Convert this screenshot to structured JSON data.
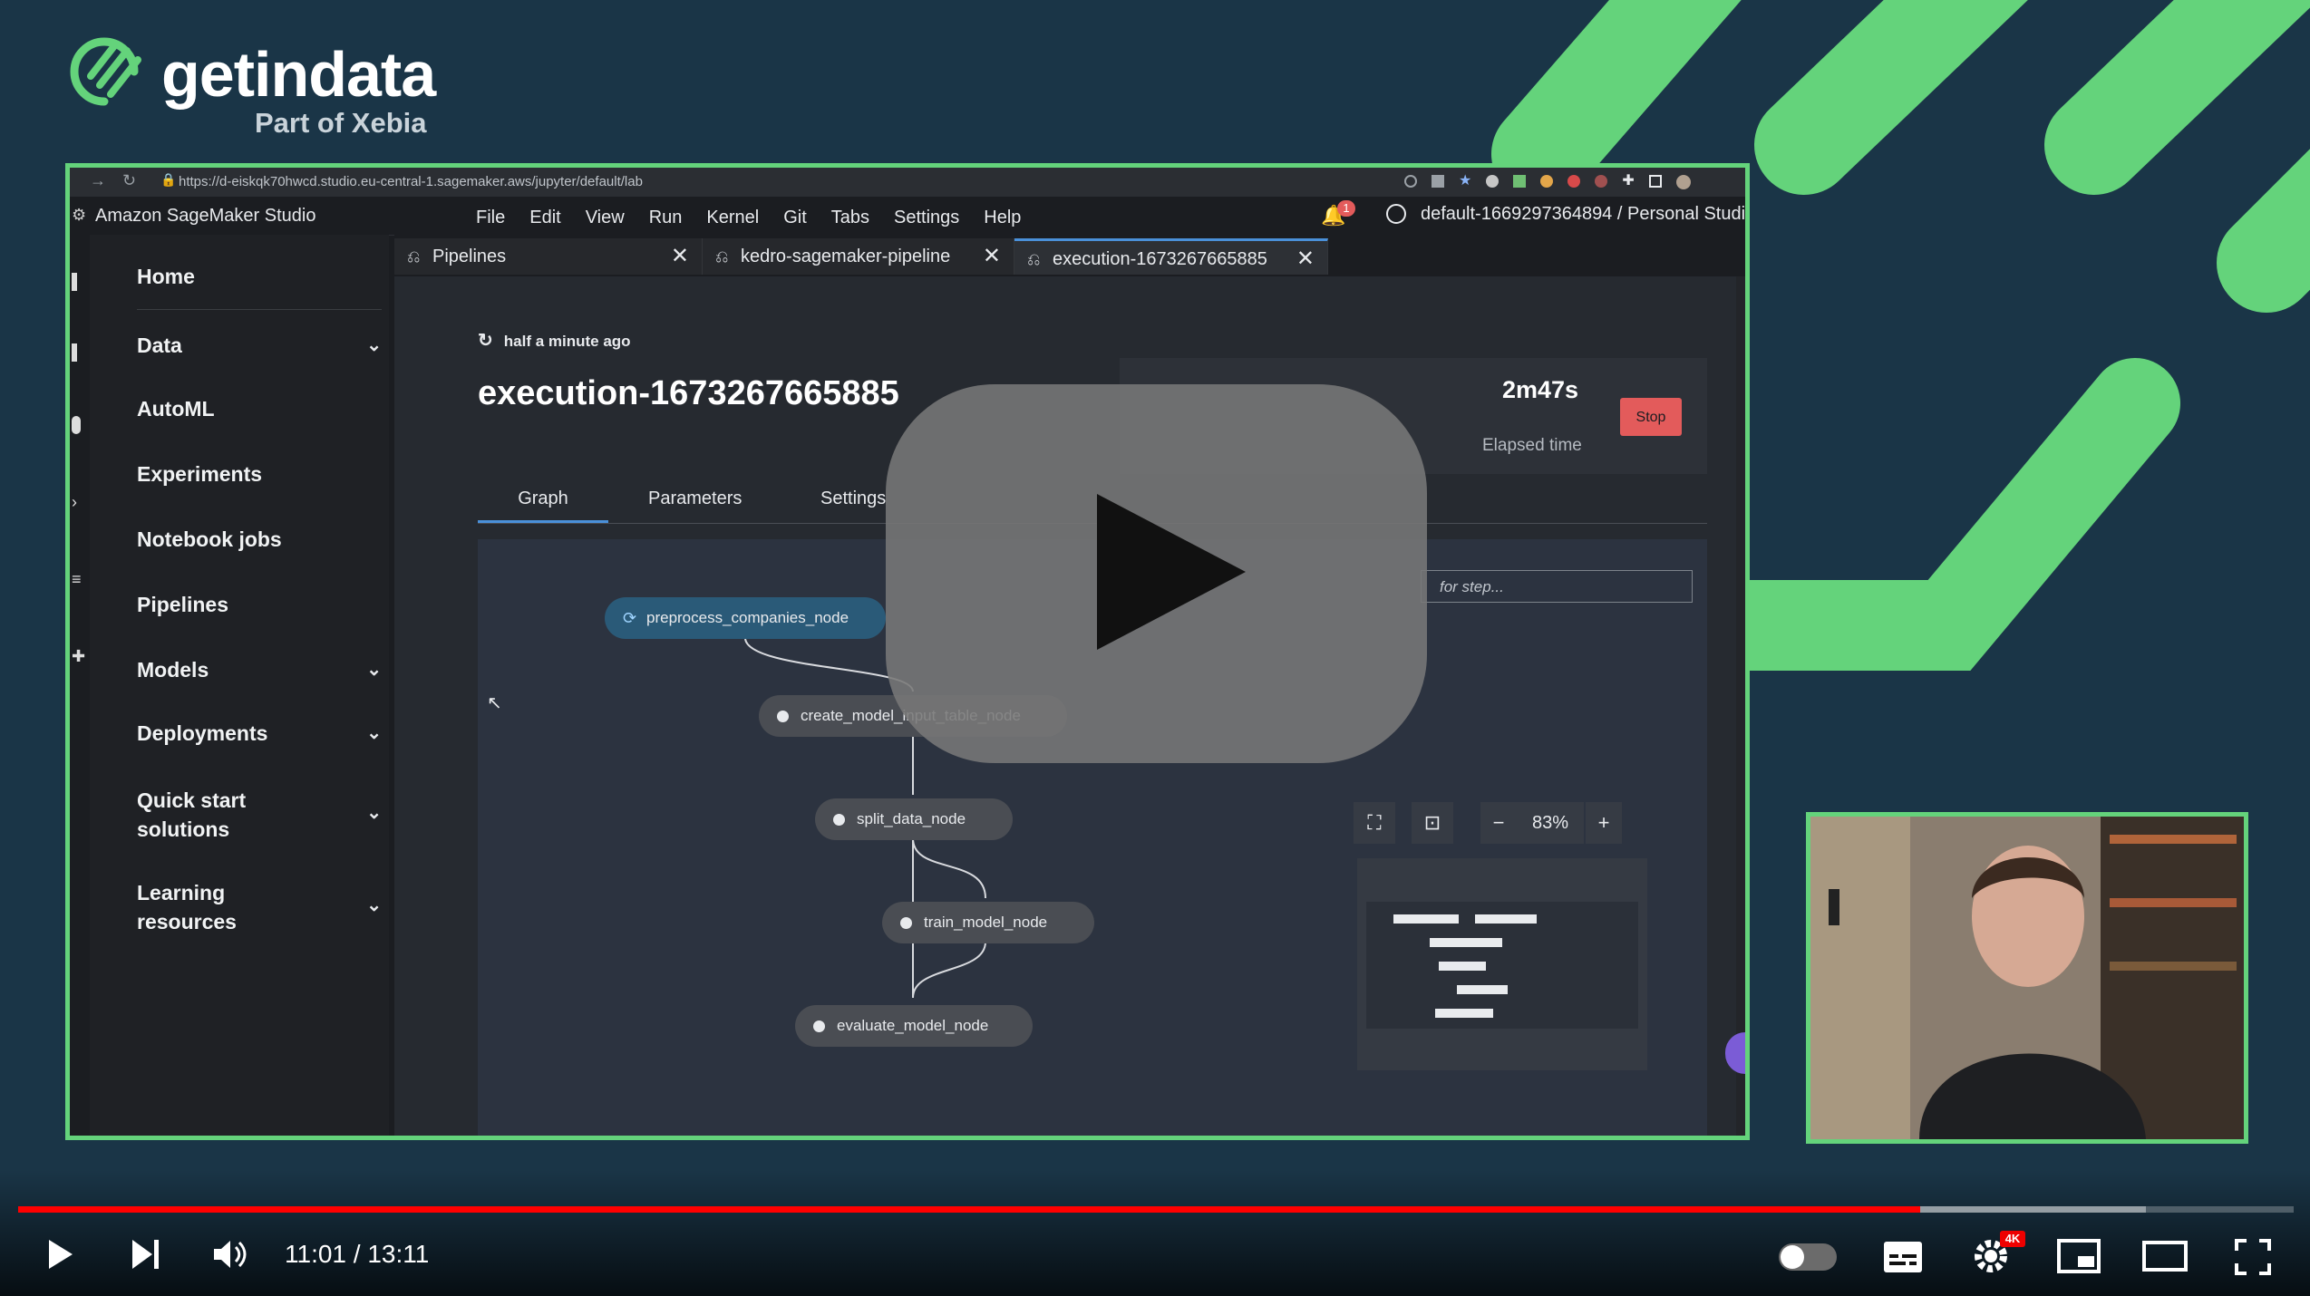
{
  "brand": {
    "name": "getindata",
    "tagline": "Part of Xebia",
    "accent": "#64d37b"
  },
  "browser": {
    "url": "https://d-eiskqk70hwcd.studio.eu-central-1.sagemaker.aws/jupyter/default/lab",
    "notification_count": "1"
  },
  "app": {
    "title": "Amazon SageMaker Studio",
    "menu": [
      "File",
      "Edit",
      "View",
      "Run",
      "Kernel",
      "Git",
      "Tabs",
      "Settings",
      "Help"
    ],
    "user": "default-1669297364894 / Personal Studi"
  },
  "sidebar": {
    "items": [
      {
        "label": "Home"
      },
      {
        "label": "Data"
      },
      {
        "label": "AutoML"
      },
      {
        "label": "Experiments"
      },
      {
        "label": "Notebook jobs"
      },
      {
        "label": "Pipelines"
      },
      {
        "label": "Models"
      },
      {
        "label": "Deployments"
      },
      {
        "label": "Quick start solutions"
      },
      {
        "label": "Learning resources"
      }
    ]
  },
  "tabs": [
    {
      "label": "Pipelines"
    },
    {
      "label": "kedro-sagemaker-pipeline"
    },
    {
      "label": "execution-1673267665885"
    }
  ],
  "execution": {
    "status": "half a minute ago",
    "title": "execution-1673267665885",
    "elapsed": "2m47s",
    "elapsed_label": "Elapsed time",
    "stop_label": "Stop",
    "subtabs": [
      "Graph",
      "Parameters",
      "Settings"
    ]
  },
  "graph": {
    "search_placeholder": "for step...",
    "nodes": [
      {
        "label": "preprocess_companies_node",
        "state": "running"
      },
      {
        "label": "create_model_input_table_node",
        "state": "pending"
      },
      {
        "label": "split_data_node",
        "state": "pending"
      },
      {
        "label": "train_model_node",
        "state": "pending"
      },
      {
        "label": "evaluate_model_node",
        "state": "pending"
      }
    ],
    "zoom": "83%"
  },
  "player": {
    "current_time": "11:01",
    "duration": "13:11",
    "time_display": "11:01 / 13:11",
    "progress_fraction": 0.836,
    "buffered_fraction": 0.935,
    "quality_badge": "4K"
  }
}
